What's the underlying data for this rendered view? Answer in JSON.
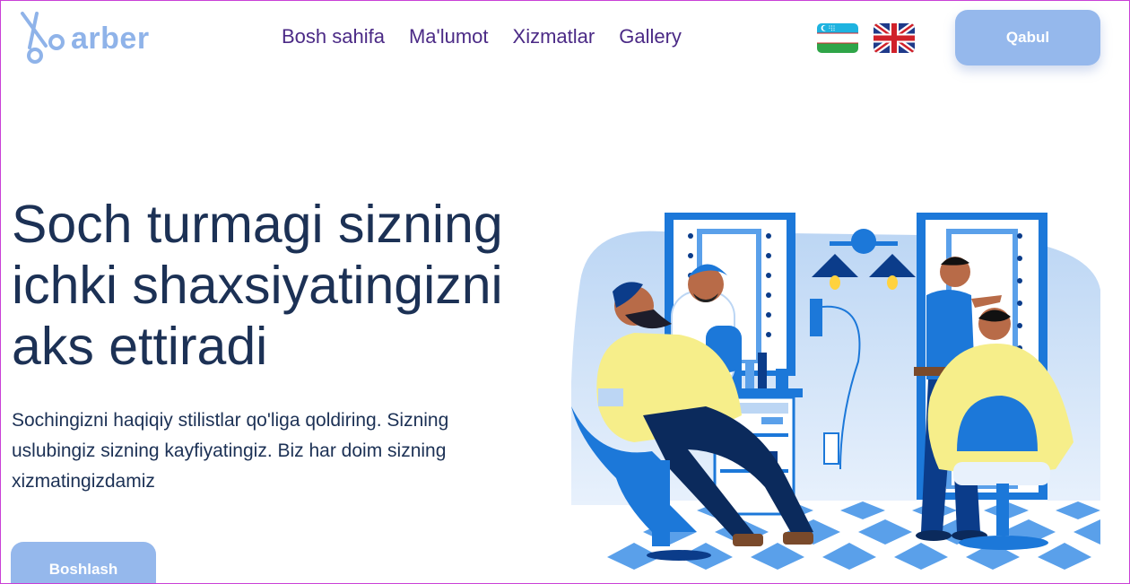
{
  "header": {
    "logo": {
      "text": "arber",
      "icon": "scissors-icon"
    },
    "nav": [
      "Bosh sahifa",
      "Ma'lumot",
      "Xizmatlar",
      "Gallery"
    ],
    "languages": [
      {
        "name": "uz-flag-icon"
      },
      {
        "name": "gb-flag-icon"
      }
    ],
    "cta_label": "Qabul"
  },
  "hero": {
    "title": "Soch turmagi sizning ichki shaxsiyatingizni aks ettiradi",
    "description": "Sochingizni haqiqiy stilistlar qo'liga qoldiring. Sizning uslubingiz sizning kayfiyatingiz. Biz har doim sizning xizmatingizdamiz",
    "button_label": "Boshlash",
    "illustration": "barbershop-illustration"
  },
  "colors": {
    "accent": "#95b8ec",
    "nav_text": "#4b2a86",
    "heading": "#1c3155",
    "frame_border": "#c940d6"
  }
}
